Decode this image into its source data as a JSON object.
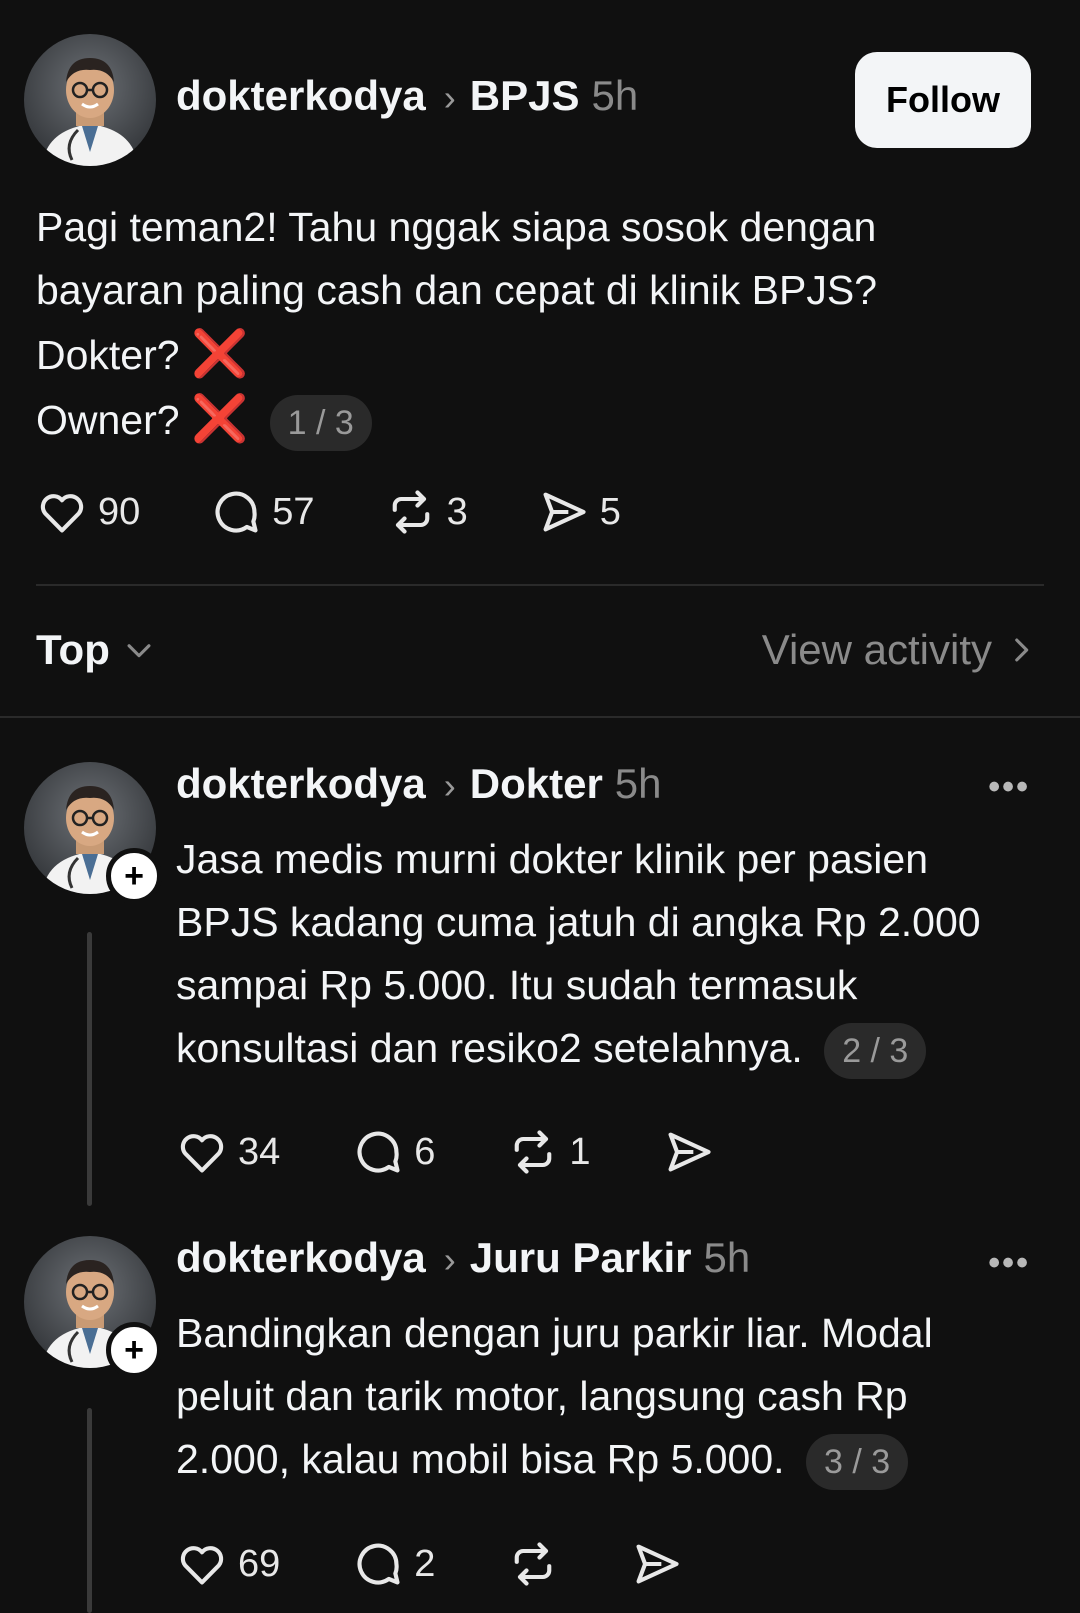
{
  "main_post": {
    "username": "dokterkodya",
    "topic": "BPJS",
    "time": "5h",
    "follow_label": "Follow",
    "lines": [
      "Pagi teman2! Tahu nggak siapa sosok dengan",
      "bayaran paling cash dan cepat di klinik BPJS?",
      "Dokter?",
      "Owner?"
    ],
    "emoji": "❌",
    "page_indicator": "1 / 3",
    "likes": "90",
    "replies": "57",
    "reposts": "3",
    "shares": "5"
  },
  "sort_bar": {
    "sort_label": "Top",
    "view_activity_label": "View activity"
  },
  "replies": [
    {
      "username": "dokterkodya",
      "topic": "Dokter",
      "time": "5h",
      "lines": [
        "Jasa medis murni dokter klinik per pasien",
        "BPJS kadang cuma jatuh di angka Rp 2.000",
        "sampai Rp 5.000. Itu sudah termasuk",
        "konsultasi dan resiko2 setelahnya."
      ],
      "page_indicator": "2 / 3",
      "likes": "34",
      "replies": "6",
      "reposts": "1"
    },
    {
      "username": "dokterkodya",
      "topic": "Juru Parkir",
      "time": "5h",
      "lines": [
        "Bandingkan dengan juru parkir liar. Modal",
        "peluit dan tarik motor, langsung cash Rp",
        "2.000, kalau mobil bisa Rp 5.000."
      ],
      "page_indicator": "3 / 3",
      "likes": "69",
      "replies": "2",
      "reposts": ""
    }
  ],
  "icons": {
    "like": "heart-icon",
    "reply": "comment-icon",
    "repost": "repost-icon",
    "share": "send-icon",
    "more": "more-icon",
    "chevron": "chevron-right-icon",
    "follow_plus": "plus-icon"
  },
  "colors": {
    "background": "#101010",
    "text": "#f3f5f7",
    "muted": "#8a8a8a",
    "pill_bg": "#2a2a2a",
    "x_mark": "#e8383f"
  }
}
